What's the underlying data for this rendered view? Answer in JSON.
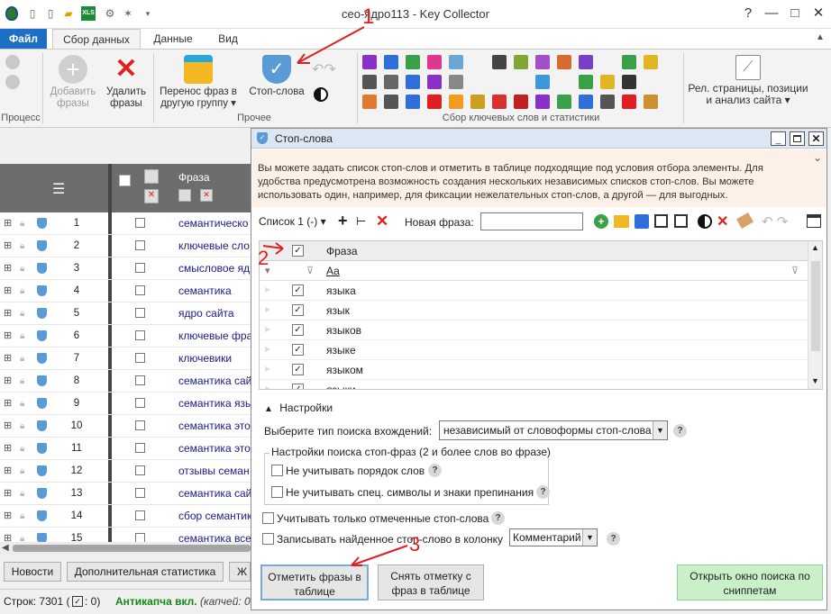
{
  "window": {
    "title": "сео-ядро113 - Key Collector",
    "help": "?",
    "minimize": "—",
    "maximize": "□",
    "close": "✕"
  },
  "tabs": {
    "file": "Файл",
    "collect": "Сбор данных",
    "data": "Данные",
    "view": "Вид"
  },
  "ribbon": {
    "process_label": "Процесс",
    "add_phrases": "Добавить\nфразы",
    "delete_phrases": "Удалить\nфразы",
    "transfer_phrases": "Перенос фраз в\nдругую группу ▾",
    "stop_words": "Стоп-слова",
    "other_label": "Прочее",
    "collect_stats_label": "Сбор ключевых слов и статистики",
    "rel_pages": "Рел. страницы, позиции\nи анализ сайта ▾"
  },
  "grid": {
    "phrase_col": "Фраза",
    "rows": [
      {
        "n": "1",
        "phrase": "семантическо"
      },
      {
        "n": "2",
        "phrase": "ключевые сло"
      },
      {
        "n": "3",
        "phrase": "смысловое яд"
      },
      {
        "n": "4",
        "phrase": "семантика"
      },
      {
        "n": "5",
        "phrase": "ядро сайта"
      },
      {
        "n": "6",
        "phrase": "ключевые фра"
      },
      {
        "n": "7",
        "phrase": "ключевики"
      },
      {
        "n": "8",
        "phrase": "семантика сай"
      },
      {
        "n": "9",
        "phrase": "семантика язы"
      },
      {
        "n": "10",
        "phrase": "семантика это"
      },
      {
        "n": "11",
        "phrase": "семантика это"
      },
      {
        "n": "12",
        "phrase": "отзывы семан"
      },
      {
        "n": "13",
        "phrase": "семантика сай"
      },
      {
        "n": "14",
        "phrase": "сбор семантик"
      },
      {
        "n": "15",
        "phrase": "семантика все"
      }
    ]
  },
  "bottom": {
    "news": "Новости",
    "extra_stats": "Дополнительная статистика",
    "cut_tab": "Ж",
    "rows_count": "Строк: 7301 (",
    "checked_count": ": 0)",
    "anticaptcha": "Антикапча вкл.",
    "captcha": "(капчей: 0"
  },
  "dialog": {
    "title": "Стоп-слова",
    "info": "Вы можете задать список стоп-слов и отметить в таблице подходящие под условия отбора элементы. Для удобства предусмотрена возможность создания нескольких независимых списков стоп-слов. Вы можете использовать один, например, для фиксации нежелательных стоп-слов, а другой — для выгодных.",
    "list_select": "Список 1 (-) ▾",
    "new_phrase_label": "Новая фраза:",
    "new_phrase_value": "",
    "phrase_col": "Фраза",
    "filter_aa": "Аа",
    "words": [
      "языка",
      "язык",
      "языков",
      "языке",
      "языком",
      "языки"
    ],
    "settings_toggle": "Настройки",
    "search_type_label": "Выберите тип поиска вхождений:",
    "search_type_value": "независимый от словоформы стоп-слова",
    "group_title": "Настройки поиска стоп-фраз (2 и более слов во фразе)",
    "ignore_order": "Не учитывать порядок слов",
    "ignore_symbols": "Не учитывать спец. символы и знаки препинания",
    "only_marked": "Учитывать только отмеченные стоп-слова",
    "write_found": "Записывать найденное стоп-слово в колонку",
    "column_value": "Комментарий",
    "mark_btn": "Отметить фразы в\nтаблице",
    "unmark_btn": "Снять отметку с\nфраз в таблице",
    "snippets_btn": "Открыть окно поиска по\nсниппетам"
  },
  "annotations": {
    "n1": "1",
    "n2": "2",
    "n3": "3"
  },
  "colors": {
    "accent": "#1c6fc4",
    "link": "#1a1a8c",
    "annotation": "#e02020",
    "snippets_bg": "#c9f0c9",
    "info_bg": "#fdf1e7",
    "anticaptcha": "#138a13"
  }
}
